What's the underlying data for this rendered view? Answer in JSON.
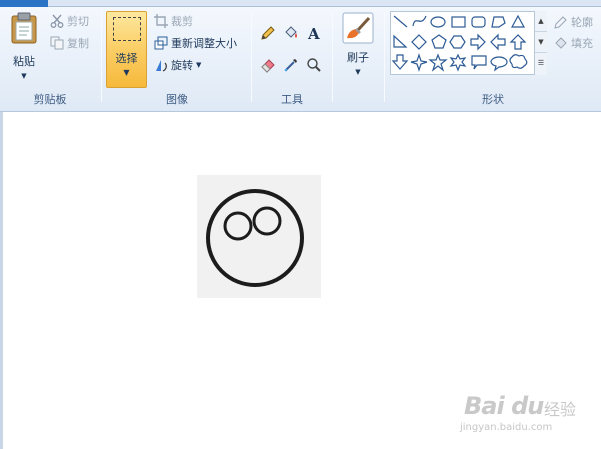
{
  "ribbon": {
    "clipboard": {
      "group_label": "剪贴板",
      "paste_label": "粘贴",
      "cut_label": "剪切",
      "copy_label": "复制"
    },
    "image": {
      "group_label": "图像",
      "select_label": "选择",
      "crop_label": "裁剪",
      "resize_label": "重新调整大小",
      "rotate_label": "旋转"
    },
    "tools": {
      "group_label": "工具",
      "items": [
        "pencil-icon",
        "fill-bucket-icon",
        "text-icon",
        "eraser-icon",
        "color-picker-icon",
        "magnifier-icon"
      ]
    },
    "brushes": {
      "label": "刷子"
    },
    "shapes": {
      "group_label": "形状",
      "outline_label": "轮廓",
      "fill_label": "填充"
    }
  },
  "watermark": {
    "brand": "Bai du",
    "site": "jingyan.baidu.com",
    "cn": "经验"
  }
}
